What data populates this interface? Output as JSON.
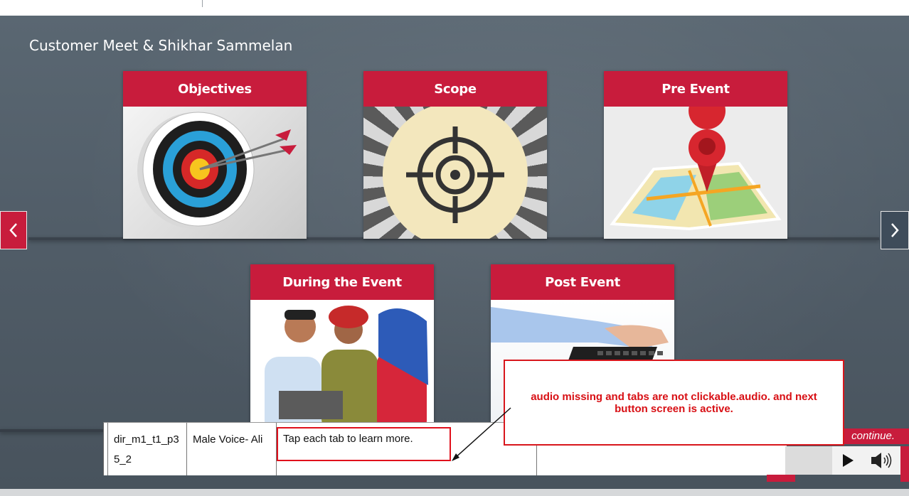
{
  "page": {
    "title": "Customer Meet & Shikhar Sammelan"
  },
  "cards": [
    {
      "label": "Objectives",
      "image": "dartboard-with-arrows"
    },
    {
      "label": "Scope",
      "image": "target-crosshair"
    },
    {
      "label": "Pre Event",
      "image": "map-with-pin"
    },
    {
      "label": "During the Event",
      "image": "people-with-laptop"
    },
    {
      "label": "Post Event",
      "image": "hands-on-keyboard"
    }
  ],
  "nav": {
    "prev_icon": "chevron-left-icon",
    "next_icon": "chevron-right-icon"
  },
  "script_table": {
    "id": "dir_m1_t1_p35_2",
    "voice": "Male Voice- Ali",
    "narration": "Tap each tab to learn more."
  },
  "review_note": "audio missing and tabs are not clickable.audio. and next button screen is active.",
  "player": {
    "continue_text": "continue.",
    "play_icon": "play-icon",
    "volume_icon": "volume-icon"
  },
  "colors": {
    "accent": "#c81c3c",
    "background": "#505c67",
    "note_red": "#d80f14"
  }
}
